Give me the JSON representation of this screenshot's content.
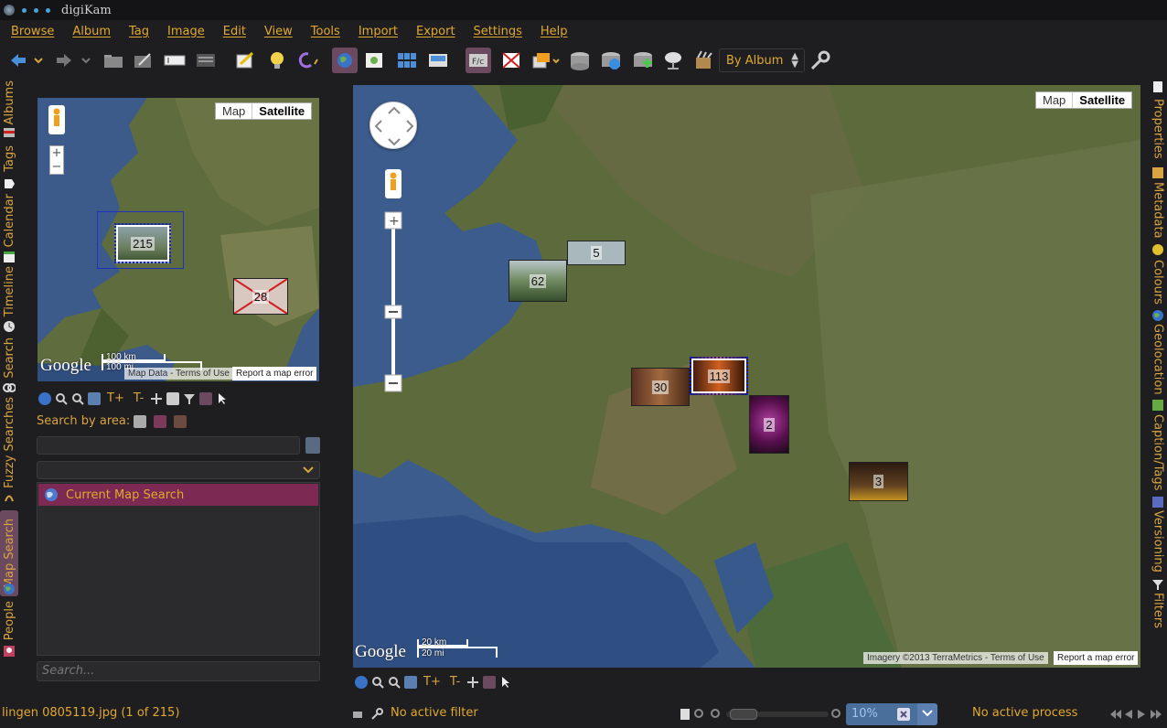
{
  "window": {
    "title": "digiKam"
  },
  "menu": [
    "Browse",
    "Album",
    "Tag",
    "Image",
    "Edit",
    "View",
    "Tools",
    "Import",
    "Export",
    "Settings",
    "Help"
  ],
  "toolbar": {
    "sort_combo": "By Album",
    "icons": [
      "back-arrow-icon",
      "back-dropdown-icon",
      "forward-arrow-icon",
      "forward-dropdown-icon",
      "new-album-icon",
      "edit-album-icon",
      "rename-icon",
      "properties-icon",
      "edit-image-icon",
      "light-table-icon",
      "rotate-icon",
      "map-view-icon",
      "preview-icon",
      "thumbnail-view-icon",
      "table-view-icon",
      "fullscreen-icon",
      "slideshow-icon",
      "batch-queue-icon",
      "import-icon",
      "export-icon",
      "add-camera-icon",
      "network-icon",
      "tools-icon",
      "settings-icon"
    ]
  },
  "left_tabs": [
    "Albums",
    "Tags",
    "Calendar",
    "Timeline",
    "Search",
    "Fuzzy Searches",
    "Map Search",
    "People"
  ],
  "right_tabs": [
    "Properties",
    "Metadata",
    "Colours",
    "Geolocation",
    "Caption/Tags",
    "Versioning",
    "Filters"
  ],
  "left_panel": {
    "minimap": {
      "map_type": {
        "map": "Map",
        "satellite": "Satellite"
      },
      "clusters": [
        {
          "count": "215",
          "selected": true
        },
        {
          "count": "28",
          "selected": false
        }
      ],
      "google_logo": "Google",
      "scale_km": "100 km",
      "scale_mi": "100 mi",
      "attribution": "Map Data - Terms of Use",
      "report": "Report a map error"
    },
    "zoom_tools": {
      "t_plus": "T+",
      "t_minus": "T-"
    },
    "search_by_area": "Search by area:",
    "searches": [
      {
        "label": "Current Map Search"
      }
    ],
    "search_placeholder": "Search..."
  },
  "main_map": {
    "map_type": {
      "map": "Map",
      "satellite": "Satellite"
    },
    "clusters": [
      {
        "count": "5",
        "selected": false
      },
      {
        "count": "62",
        "selected": false
      },
      {
        "count": "30",
        "selected": false
      },
      {
        "count": "113",
        "selected": true
      },
      {
        "count": "2",
        "selected": false
      },
      {
        "count": "3",
        "selected": false
      }
    ],
    "google_logo": "Google",
    "scale_km": "20 km",
    "scale_mi": "20 mi",
    "attribution": "Imagery ©2013 TerraMetrics - Terms of Use",
    "report": "Report a map error",
    "tools": {
      "t_plus": "T+",
      "t_minus": "T-"
    }
  },
  "status": {
    "file": "lingen 0805119.jpg (1 of 215)",
    "filter": "No active filter",
    "zoom": "10%",
    "process": "No active process"
  },
  "colors": {
    "accent_text": "#e0a830",
    "selection": "#7c2a53",
    "active_tool": "#6b4a60",
    "zoom_field": "#4a6f9a"
  }
}
